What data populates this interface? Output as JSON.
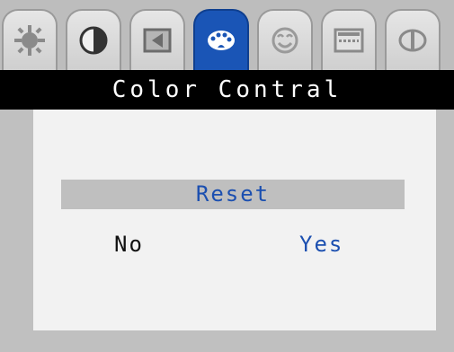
{
  "tabs": [
    {
      "icon": "brightness-icon",
      "active": false
    },
    {
      "icon": "contrast-icon",
      "active": false
    },
    {
      "icon": "position-icon",
      "active": false
    },
    {
      "icon": "color-palette-icon",
      "active": true
    },
    {
      "icon": "face-icon",
      "active": false
    },
    {
      "icon": "keyboard-icon",
      "active": false
    },
    {
      "icon": "info-icon",
      "active": false
    }
  ],
  "colors": {
    "accent": "#1a55b6",
    "title_bg": "#000000"
  },
  "title": "Color Contral",
  "menu": {
    "reset_label": "Reset",
    "no_label": "No",
    "yes_label": "Yes"
  }
}
